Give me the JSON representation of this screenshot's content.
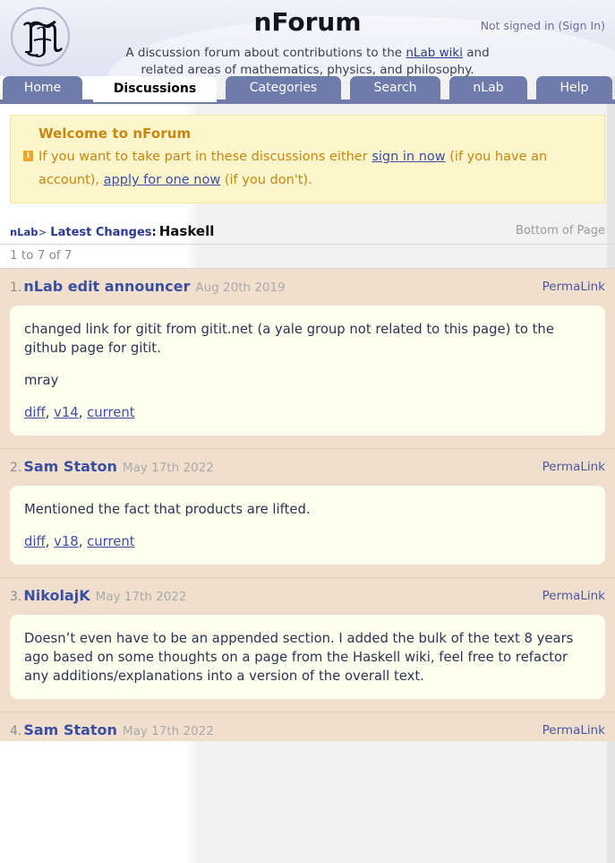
{
  "site": {
    "title": "nForum",
    "logo_icon": "nlab-fraktur-n-logo",
    "signed_in_status": "Not signed in (",
    "sign_in_label": "Sign In",
    "signed_in_status_close": ")",
    "tagline_line1_pre": "A discussion forum about contributions to the ",
    "tagline_link": "nLab wiki",
    "tagline_line1_post": " and",
    "tagline_line2": "related areas of mathematics, physics, and philosophy."
  },
  "tabs": [
    {
      "label": "Home",
      "active": false
    },
    {
      "label": "Discussions",
      "active": true
    },
    {
      "label": "Categories",
      "active": false
    },
    {
      "label": "Search",
      "active": false
    },
    {
      "label": "nLab",
      "active": false
    },
    {
      "label": "Help",
      "active": false
    }
  ],
  "welcome": {
    "icon": "info-icon",
    "icon_glyph": "i",
    "title": "Welcome to nForum",
    "text_1": "If you want to take part in these discussions either ",
    "link_1": "sign in now",
    "text_2": " (if you have an account), ",
    "link_2": "apply for one now",
    "text_3": " (if you don't)."
  },
  "breadcrumb": {
    "root": "nLab",
    "separator": ">",
    "category": "Latest Changes",
    "colon": ":",
    "page": "Haskell",
    "bottom_of_page": "Bottom of Page"
  },
  "pagination": {
    "count_text": "1 to 7 of 7"
  },
  "posts": [
    {
      "number": "1.",
      "author": "nLab edit announcer",
      "date": "Aug 20th 2019",
      "permalink": "PermaLink",
      "paragraphs": [
        "changed link for gitit from gitit.net (a yale group not related to this page) to the github page for gitit.",
        "mray"
      ],
      "revlinks": {
        "diff": "diff",
        "sep1": ", ",
        "version": "v14",
        "sep2": ", ",
        "current": "current"
      }
    },
    {
      "number": "2.",
      "author": "Sam Staton",
      "date": "May 17th 2022",
      "permalink": "PermaLink",
      "paragraphs": [
        "Mentioned the fact that products are lifted."
      ],
      "revlinks": {
        "diff": "diff",
        "sep1": ", ",
        "version": "v18",
        "sep2": ", ",
        "current": "current"
      }
    },
    {
      "number": "3.",
      "author": "NikolajK",
      "date": "May 17th 2022",
      "permalink": "PermaLink",
      "paragraphs": [
        "Doesn’t even have to be an appended section. I added the bulk of the text 8 years ago based on some thoughts on a page from the Haskell wiki, feel free to refactor any additions/explanations into a version of the overall text."
      ],
      "revlinks": null
    },
    {
      "number": "4.",
      "author": "Sam Staton",
      "date": "May 17th 2022",
      "permalink": "PermaLink",
      "paragraphs": [],
      "revlinks": null
    }
  ],
  "colors": {
    "tab_blue": "#6e7bab",
    "post_surround": "#f1dfce",
    "post_body": "#fffff0",
    "welcome_bg": "#fdf5cb",
    "welcome_text": "#c8860d",
    "link_blue": "#3b4fa0"
  }
}
